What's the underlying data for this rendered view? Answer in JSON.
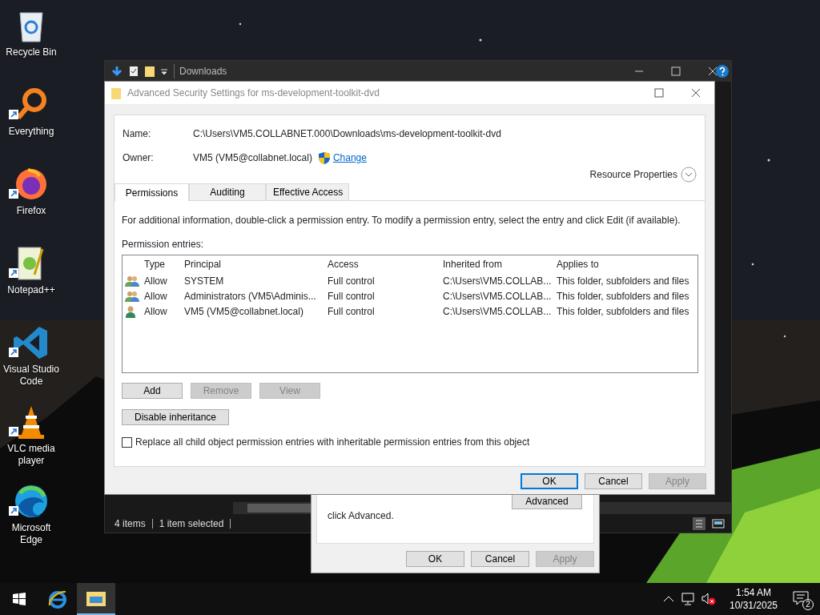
{
  "desktop_icons": [
    {
      "label": "Recycle Bin",
      "kind": "recycle",
      "shortcut": false
    },
    {
      "label": "Everything",
      "kind": "everything",
      "shortcut": true
    },
    {
      "label": "Firefox",
      "kind": "firefox",
      "shortcut": true
    },
    {
      "label": "Notepad++",
      "kind": "notepad",
      "shortcut": true
    },
    {
      "label": "Visual Studio Code",
      "kind": "vscode",
      "shortcut": true
    },
    {
      "label": "VLC media player",
      "kind": "vlc",
      "shortcut": true
    },
    {
      "label": "Microsoft Edge",
      "kind": "edge",
      "shortcut": true
    }
  ],
  "explorer": {
    "title": "Downloads",
    "status": [
      "4 items",
      "1 item selected"
    ]
  },
  "properties_dialog": {
    "text": "click Advanced.",
    "advanced_button": "Advanced",
    "buttons": [
      {
        "label": "OK",
        "disabled": false
      },
      {
        "label": "Cancel",
        "disabled": false
      },
      {
        "label": "Apply",
        "disabled": true
      }
    ]
  },
  "security_dialog": {
    "title": "Advanced Security Settings for ms-development-toolkit-dvd",
    "name_label": "Name:",
    "name_value": "C:\\Users\\VM5.COLLABNET.000\\Downloads\\ms-development-toolkit-dvd",
    "owner_label": "Owner:",
    "owner_value": "VM5 (VM5@collabnet.local)",
    "change_link": "Change",
    "resource_properties": "Resource Properties",
    "tabs": [
      {
        "label": "Permissions",
        "selected": true
      },
      {
        "label": "Auditing",
        "selected": false
      },
      {
        "label": "Effective Access",
        "selected": false
      }
    ],
    "info": "For additional information, double-click a permission entry. To modify a permission entry, select the entry and click Edit (if available).",
    "entries_label": "Permission entries:",
    "columns": [
      "Type",
      "Principal",
      "Access",
      "Inherited from",
      "Applies to"
    ],
    "rows": [
      {
        "kind": "group",
        "cells": [
          "Allow",
          "SYSTEM",
          "Full control",
          "C:\\Users\\VM5.COLLAB...",
          "This folder, subfolders and files"
        ]
      },
      {
        "kind": "group",
        "cells": [
          "Allow",
          "Administrators (VM5\\Adminis...",
          "Full control",
          "C:\\Users\\VM5.COLLAB...",
          "This folder, subfolders and files"
        ]
      },
      {
        "kind": "user",
        "cells": [
          "Allow",
          "VM5 (VM5@collabnet.local)",
          "Full control",
          "C:\\Users\\VM5.COLLAB...",
          "This folder, subfolders and files"
        ]
      }
    ],
    "entry_buttons": [
      {
        "label": "Add",
        "disabled": false
      },
      {
        "label": "Remove",
        "disabled": true
      },
      {
        "label": "View",
        "disabled": true
      }
    ],
    "inheritance_button": "Disable inheritance",
    "replace_checkbox": {
      "label": "Replace all child object permission entries with inheritable permission entries from this object",
      "checked": false
    },
    "buttons": [
      {
        "label": "OK",
        "disabled": false,
        "default": true
      },
      {
        "label": "Cancel",
        "disabled": false,
        "default": false
      },
      {
        "label": "Apply",
        "disabled": true,
        "default": false
      }
    ]
  },
  "taskbar": {
    "apps": [
      {
        "kind": "ie",
        "active": false
      },
      {
        "kind": "explorer",
        "active": true
      }
    ],
    "time": "1:54 AM",
    "date": "10/31/2025",
    "notifications": "2"
  }
}
